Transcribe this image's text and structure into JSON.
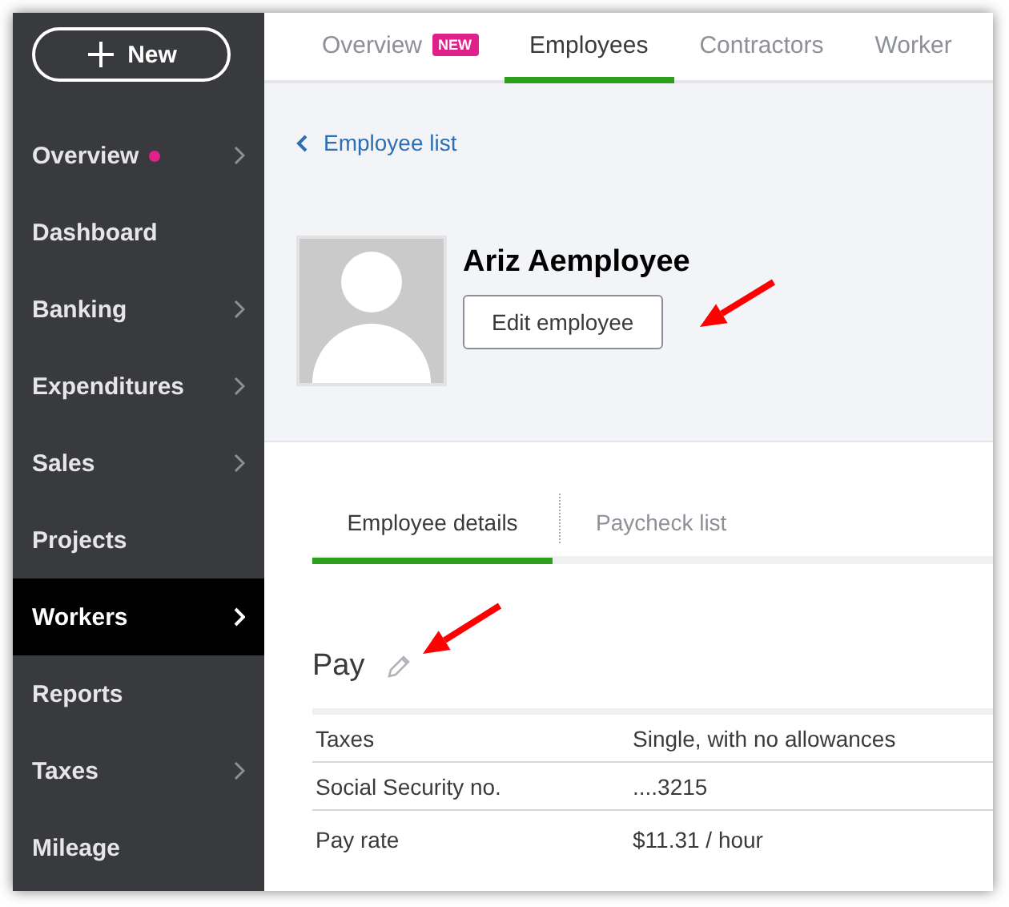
{
  "sidebar": {
    "new_button": {
      "label": "New"
    },
    "items": [
      {
        "label": "Overview",
        "color": "#e0218a",
        "has_submenu": true,
        "selected": false
      },
      {
        "label": "Dashboard",
        "has_submenu": false,
        "selected": false
      },
      {
        "label": "Banking",
        "has_submenu": true,
        "selected": false
      },
      {
        "label": "Expenditures",
        "has_submenu": true,
        "selected": false
      },
      {
        "label": "Sales",
        "has_submenu": true,
        "selected": false
      },
      {
        "label": "Projects",
        "has_submenu": false,
        "selected": false
      },
      {
        "label": "Workers",
        "has_submenu": true,
        "selected": true
      },
      {
        "label": "Reports",
        "has_submenu": false,
        "selected": false
      },
      {
        "label": "Taxes",
        "has_submenu": true,
        "selected": false
      },
      {
        "label": "Mileage",
        "has_submenu": false,
        "selected": false
      }
    ]
  },
  "top_tabs": [
    {
      "label": "Overview",
      "badge": "NEW",
      "selected": false
    },
    {
      "label": "Employees",
      "selected": true
    },
    {
      "label": "Contractors",
      "selected": false
    },
    {
      "label": "Worker",
      "selected": false
    }
  ],
  "back_link": "Employee list",
  "employee": {
    "name": "Ariz Aemployee",
    "edit_button": "Edit employee"
  },
  "detail_tabs": [
    {
      "label": "Employee details",
      "selected": true
    },
    {
      "label": "Paycheck list",
      "selected": false
    }
  ],
  "pay": {
    "title": "Pay",
    "rows": [
      {
        "label": "Taxes",
        "value": "Single, with no allowances"
      },
      {
        "label": "Social Security no.",
        "value": "....3215"
      },
      {
        "label": "Pay rate",
        "value": "$11.31 / hour"
      }
    ]
  },
  "annotations": [
    {
      "kind": "arrow"
    },
    {
      "kind": "arrow"
    }
  ]
}
